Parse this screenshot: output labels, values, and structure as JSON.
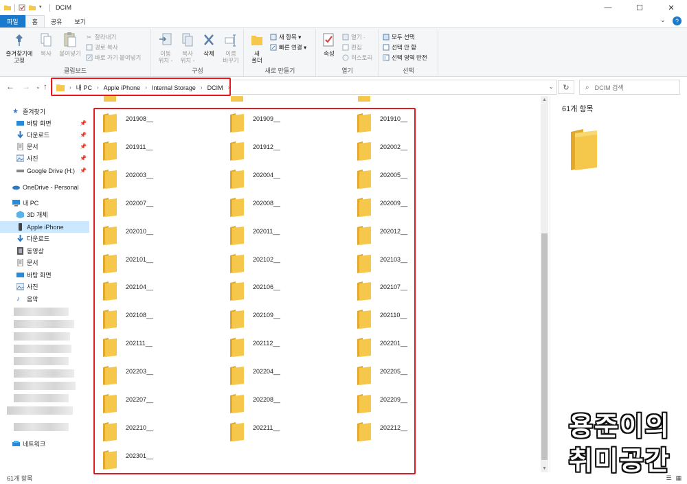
{
  "window": {
    "title": "DCIM",
    "minimize": "—",
    "maximize": "☐",
    "close": "✕"
  },
  "ribbon_tabs": [
    {
      "label": "파일"
    },
    {
      "label": "홈"
    },
    {
      "label": "공유"
    },
    {
      "label": "보기"
    }
  ],
  "ribbon": {
    "clipboard": {
      "label": "클립보드",
      "pin_quick": "즐겨찾기에\n고정",
      "copy": "복사",
      "paste": "붙여넣기",
      "cut": "잘라내기",
      "copy_path": "경로 복사",
      "paste_shortcut": "바로 가기 붙여넣기"
    },
    "organize": {
      "label": "구성",
      "move_to": "이동\n위치 -",
      "copy_to": "복사\n위치 -",
      "delete": "삭제",
      "rename": "이름\n바꾸기"
    },
    "new": {
      "label": "새로 만들기",
      "new_folder": "새\n폴더",
      "new_item": "새 항목 ▾",
      "easy_access": "빠른 연결 ▾"
    },
    "open": {
      "label": "열기",
      "properties": "속성",
      "open": "열기 ·",
      "edit": "편집",
      "history": "히스토리"
    },
    "select": {
      "label": "선택",
      "select_all": "모두 선택",
      "select_none": "선택 안 함",
      "invert": "선택 영역 반전"
    }
  },
  "address": {
    "crumbs": [
      "내 PC",
      "Apple iPhone",
      "Internal Storage",
      "DCIM"
    ],
    "search_placeholder": "DCIM 검색"
  },
  "nav": {
    "quick_access": "즐겨찾기",
    "qa_items": [
      "바탕 화면",
      "다운로드",
      "문서",
      "사진",
      "Google Drive (H:)"
    ],
    "onedrive": "OneDrive - Personal",
    "this_pc": "내 PC",
    "pc_items": [
      "3D 개체",
      "Apple iPhone",
      "다운로드",
      "동영상",
      "문서",
      "바탕 화면",
      "사진",
      "음악"
    ],
    "network": "네트워크"
  },
  "folders": [
    "201908__",
    "201909__",
    "201910__",
    "201911__",
    "201912__",
    "202002__",
    "202003__",
    "202004__",
    "202005__",
    "202007__",
    "202008__",
    "202009__",
    "202010__",
    "202011__",
    "202012__",
    "202101__",
    "202102__",
    "202103__",
    "202104__",
    "202106__",
    "202107__",
    "202108__",
    "202109__",
    "202110__",
    "202111__",
    "202112__",
    "202201__",
    "202203__",
    "202204__",
    "202205__",
    "202207__",
    "202208__",
    "202209__",
    "202210__",
    "202211__",
    "202212__",
    "202301__"
  ],
  "details": {
    "count": "61개 항목"
  },
  "status": {
    "count": "61개 항목"
  },
  "watermark": {
    "line1": "용준이의",
    "line2": "취미공간"
  },
  "colors": {
    "highlight": "#e21a22",
    "accent": "#1979ca",
    "folder": "#f5c84c"
  }
}
